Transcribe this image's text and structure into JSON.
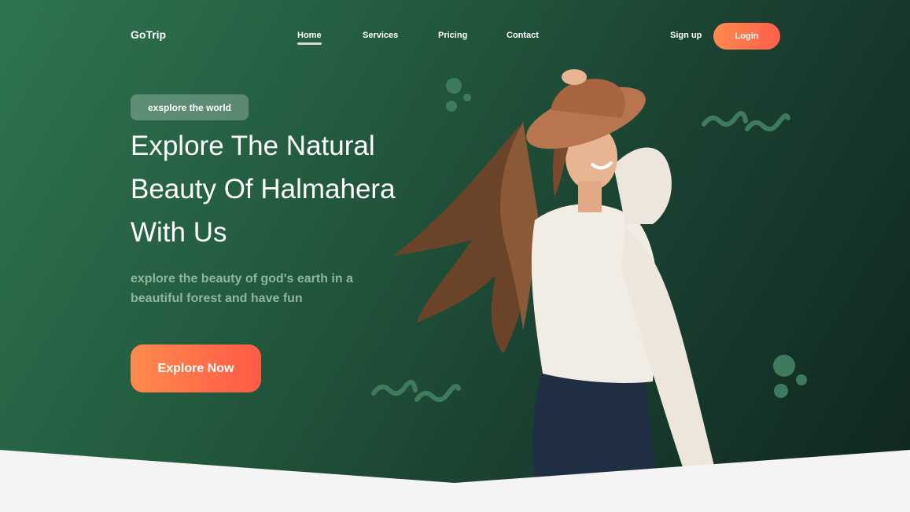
{
  "header": {
    "logo": "GoTrip",
    "nav": [
      {
        "label": "Home",
        "active": true
      },
      {
        "label": "Services",
        "active": false
      },
      {
        "label": "Pricing",
        "active": false
      },
      {
        "label": "Contact",
        "active": false
      }
    ],
    "signup_label": "Sign up",
    "login_label": "Login"
  },
  "hero": {
    "tag": "exsplore the world",
    "headline_lines": [
      "Explore The Natural",
      "Beauty Of Halmahera",
      "With Us"
    ],
    "subtext_lines": [
      "explore the beauty of god's earth in a",
      "beautiful forest and have fun"
    ],
    "cta_label": "Explore Now"
  },
  "colors": {
    "accent_start": "#ff8a4e",
    "accent_end": "#ff5f4c",
    "hero_green": "#235a3e",
    "hero_dark": "#10261f",
    "decor_green": "#3e7a5e",
    "page_bg": "#f4f4f4"
  },
  "icons": [
    "decor-dots",
    "decor-squiggle"
  ]
}
